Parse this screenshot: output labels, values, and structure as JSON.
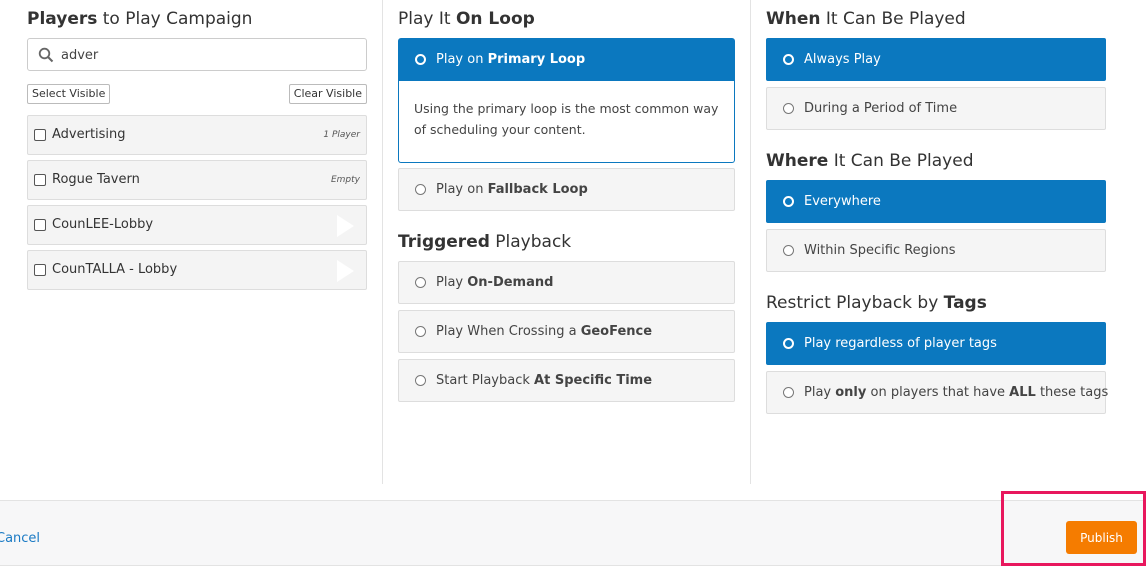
{
  "players": {
    "title_bold": "Players",
    "title_rest": " to Play Campaign",
    "search_value": "adver",
    "select_visible": "Select Visible",
    "clear_visible": "Clear Visible",
    "items": [
      {
        "name": "Advertising",
        "meta": "1 Player"
      },
      {
        "name": "Rogue Tavern",
        "meta": "Empty"
      },
      {
        "name": "CounLEE-Lobby",
        "meta": ""
      },
      {
        "name": "CounTALLA - Lobby",
        "meta": ""
      }
    ]
  },
  "loop": {
    "title_pre": "Play It ",
    "title_bold": "On Loop",
    "primary": {
      "pre": "Play on ",
      "bold": "Primary Loop"
    },
    "primary_desc": "Using the primary loop is the most common way of scheduling your content.",
    "fallback": {
      "pre": "Play on ",
      "bold": "Fallback Loop"
    }
  },
  "triggered": {
    "title_bold": "Triggered",
    "title_rest": " Playback",
    "options": [
      {
        "pre": "Play ",
        "bold": "On-Demand"
      },
      {
        "pre": "Play When Crossing a ",
        "bold": "GeoFence"
      },
      {
        "pre": "Start Playback ",
        "bold": "At Specific Time"
      }
    ]
  },
  "when": {
    "title_bold": "When",
    "title_rest": " It Can Be Played",
    "always": "Always Play",
    "period": "During a Period of Time"
  },
  "where": {
    "title_bold": "Where",
    "title_rest": " It Can Be Played",
    "everywhere": "Everywhere",
    "regions": "Within Specific Regions"
  },
  "tags": {
    "title_pre": "Restrict Playback by ",
    "title_bold": "Tags",
    "regardless": "Play regardless of player tags",
    "only_pre": "Play ",
    "only_bold1": "only",
    "only_mid": " on players that have ",
    "only_bold2": "ALL",
    "only_post": " these tags"
  },
  "footer": {
    "cancel": "Cancel",
    "publish": "Publish"
  },
  "colors": {
    "selected": "#0b78bf",
    "publish": "#f57c00",
    "highlight": "#e8175d"
  }
}
